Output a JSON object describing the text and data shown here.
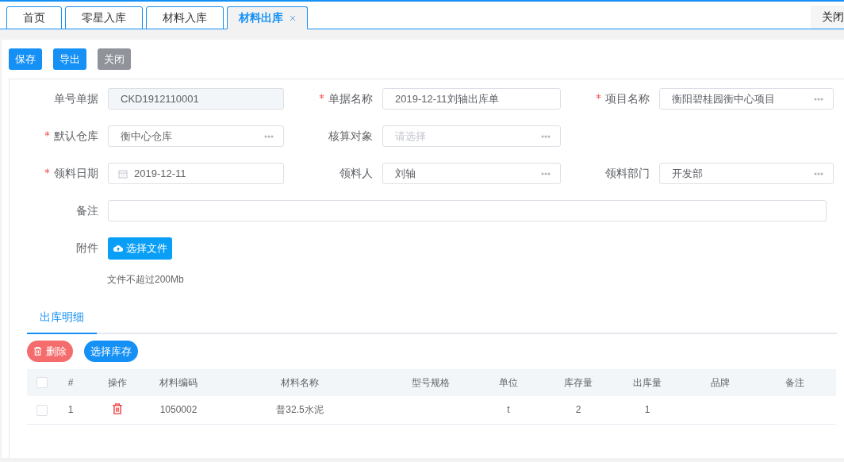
{
  "tabs": [
    {
      "label": "首页",
      "selected": false,
      "closable": false
    },
    {
      "label": "零星入库",
      "selected": false,
      "closable": false
    },
    {
      "label": "材料入库",
      "selected": false,
      "closable": false
    },
    {
      "label": "材料出库",
      "selected": true,
      "closable": true
    }
  ],
  "tab_bar_action": "关闭",
  "toolbar": [
    {
      "label": "保存",
      "kind": "primary"
    },
    {
      "label": "导出",
      "kind": "primary"
    },
    {
      "label": "关闭",
      "kind": "neutral"
    }
  ],
  "form": {
    "rows": [
      {
        "fields": [
          {
            "label": "单号单据",
            "required": false,
            "kind": "readonly",
            "value": "CKD1912110001"
          },
          {
            "label": "单据名称",
            "required": true,
            "kind": "text",
            "value": "2019-12-11刘轴出库单"
          },
          {
            "label": "项目名称",
            "required": true,
            "kind": "picker",
            "value": "衡阳碧桂园衡中心项目"
          }
        ]
      },
      {
        "fields": [
          {
            "label": "默认仓库",
            "required": true,
            "kind": "picker",
            "value": "衡中心仓库"
          },
          {
            "label": "核算对象",
            "required": false,
            "kind": "picker",
            "placeholder": "请选择"
          }
        ]
      },
      {
        "fields": [
          {
            "label": "领料日期",
            "required": true,
            "kind": "date",
            "value": "2019-12-11"
          },
          {
            "label": "领料人",
            "required": false,
            "kind": "picker",
            "value": "刘轴"
          },
          {
            "label": "领料部门",
            "required": false,
            "kind": "picker",
            "value": "开发部"
          }
        ]
      },
      {
        "fields": [
          {
            "label": "备注",
            "required": false,
            "kind": "wide"
          }
        ]
      },
      {
        "fields": [
          {
            "label": "附件",
            "required": false,
            "kind": "upload",
            "button": "选择文件"
          }
        ]
      }
    ],
    "note": "文件不超过200Mb"
  },
  "detail_tabs": [
    {
      "label": "出库明细",
      "selected": true
    }
  ],
  "detail_actions": [
    {
      "label": "删除",
      "kind": "danger"
    },
    {
      "label": "选择库存",
      "kind": "primary"
    }
  ],
  "table": {
    "select_all_checked": false,
    "columns": [
      {
        "label": "#",
        "kind": "text"
      },
      {
        "label": "操作",
        "kind": "action"
      },
      {
        "label": "材料编码",
        "kind": "text"
      },
      {
        "label": "材料名称",
        "kind": "text"
      },
      {
        "label": "型号规格",
        "kind": "text"
      },
      {
        "label": "单位",
        "kind": "text"
      },
      {
        "label": "库存量",
        "kind": "text"
      },
      {
        "label": "出库量",
        "kind": "text"
      },
      {
        "label": "品牌",
        "kind": "text"
      },
      {
        "label": "备注",
        "kind": "text"
      }
    ],
    "rows": [
      {
        "checked": false,
        "cells": [
          "1",
          null,
          "1050002",
          "普32.5水泥",
          null,
          "t",
          "2",
          "1",
          null,
          null
        ]
      }
    ]
  }
}
